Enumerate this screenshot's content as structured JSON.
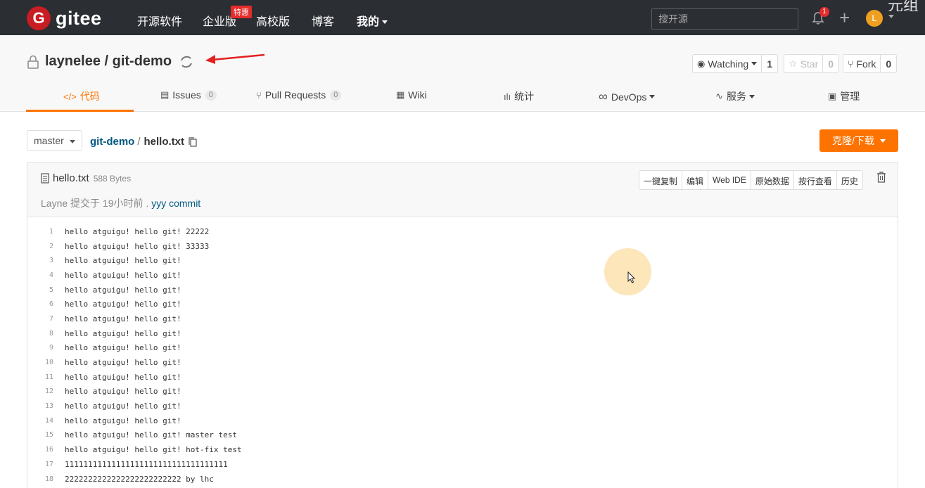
{
  "nav": {
    "logo_text": "gitee",
    "logo_mark": "G",
    "items": [
      "开源软件",
      "企业版",
      "高校版",
      "博客",
      "我的"
    ],
    "enterprise_badge": "特惠",
    "search_placeholder": "搜开源",
    "notification_count": "1",
    "avatar_initial": "L",
    "corner_text": "元组"
  },
  "repo": {
    "owner": "laynelee",
    "separator": " / ",
    "name": "git-demo",
    "watch_label": "Watching",
    "watch_count": "1",
    "star_label": "Star",
    "star_count": "0",
    "fork_label": "Fork",
    "fork_count": "0"
  },
  "tabs": [
    {
      "icon": "</>",
      "label": "代码"
    },
    {
      "icon": "▤",
      "label": "Issues",
      "count": "0"
    },
    {
      "icon": "⑂",
      "label": "Pull Requests",
      "count": "0"
    },
    {
      "icon": "▦",
      "label": "Wiki"
    },
    {
      "icon": "ılı",
      "label": "统计"
    },
    {
      "icon": "∞",
      "label": "DevOps"
    },
    {
      "icon": "∿",
      "label": "服务"
    },
    {
      "icon": "▣",
      "label": "管理"
    }
  ],
  "file": {
    "branch": "master",
    "crumb_repo": "git-demo",
    "crumb_sep": "/",
    "crumb_file": "hello.txt",
    "clone_label": "克隆/下载",
    "name": "hello.txt",
    "size": "588 Bytes",
    "commit_author": "Layne",
    "commit_text": " 提交于 19小时前 . ",
    "commit_msg": "yyy commit",
    "tools": [
      "一键复制",
      "编辑",
      "Web IDE",
      "原始数据",
      "按行查看",
      "历史"
    ]
  },
  "code_lines": [
    {
      "n": "1",
      "t": "hello atguigu! hello git! 22222"
    },
    {
      "n": "2",
      "t": "hello atguigu! hello git! 33333"
    },
    {
      "n": "3",
      "t": "hello atguigu! hello git!"
    },
    {
      "n": "4",
      "t": "hello atguigu! hello git!"
    },
    {
      "n": "5",
      "t": "hello atguigu! hello git!"
    },
    {
      "n": "6",
      "t": "hello atguigu! hello git!"
    },
    {
      "n": "7",
      "t": "hello atguigu! hello git!"
    },
    {
      "n": "8",
      "t": "hello atguigu! hello git!"
    },
    {
      "n": "9",
      "t": "hello atguigu! hello git!"
    },
    {
      "n": "10",
      "t": "hello atguigu! hello git!"
    },
    {
      "n": "11",
      "t": "hello atguigu! hello git!"
    },
    {
      "n": "12",
      "t": "hello atguigu! hello git!"
    },
    {
      "n": "13",
      "t": "hello atguigu! hello git!"
    },
    {
      "n": "14",
      "t": "hello atguigu! hello git!"
    },
    {
      "n": "15",
      "t": "hello atguigu! hello git! master test"
    },
    {
      "n": "16",
      "t": "hello atguigu! hello git! hot-fix test"
    },
    {
      "n": "17",
      "t": "11111111111111111111111111111111111"
    },
    {
      "n": "18",
      "t": "2222222222222222222222222 by lhc"
    }
  ],
  "colors": {
    "accent": "#fe7300",
    "nav_bg": "#2b2e33",
    "link": "#005980",
    "brand_red": "#c71d23"
  }
}
